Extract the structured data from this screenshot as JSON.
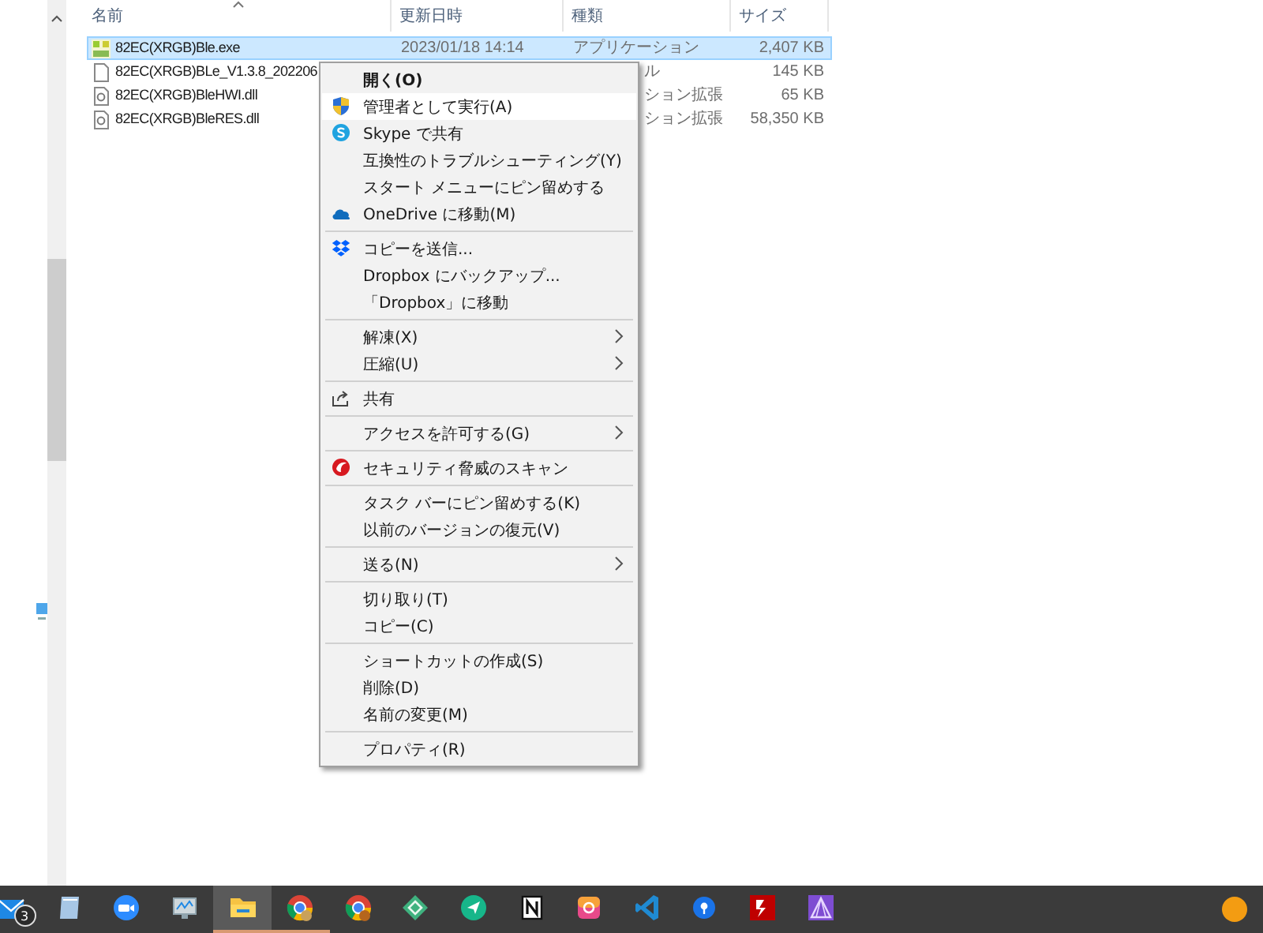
{
  "columns": [
    {
      "label": "名前",
      "sorted": true
    },
    {
      "label": "更新日時",
      "sorted": false
    },
    {
      "label": "種類",
      "sorted": false
    },
    {
      "label": "サイズ",
      "sorted": false
    }
  ],
  "files": [
    {
      "kind": "app",
      "name": "82EC(XRGB)Ble.exe",
      "date": "2023/01/18 14:14",
      "type": "アプリケーション",
      "size": "2,407 KB",
      "selected": true
    },
    {
      "kind": "file",
      "name": "82EC(XRGB)BLe_V1.3.8_202206",
      "type": "ル",
      "size": "145 KB",
      "selected": false
    },
    {
      "kind": "dll",
      "name": "82EC(XRGB)BleHWI.dll",
      "type": "ション拡張",
      "size": "65 KB",
      "selected": false
    },
    {
      "kind": "dll",
      "name": "82EC(XRGB)BleRES.dll",
      "type": "ション拡張",
      "size": "58,350 KB",
      "selected": false
    }
  ],
  "menu": [
    {
      "kind": "plain",
      "label": "開く(O)",
      "default": true,
      "selected": false,
      "submenu": false
    },
    {
      "kind": "shield",
      "label": "管理者として実行(A)",
      "default": false,
      "selected": true,
      "submenu": false
    },
    {
      "kind": "skype",
      "label": "Skype で共有",
      "default": false,
      "selected": false,
      "submenu": false
    },
    {
      "kind": "plain",
      "label": "互換性のトラブルシューティング(Y)",
      "default": false,
      "selected": false,
      "submenu": false
    },
    {
      "kind": "plain",
      "label": "スタート メニューにピン留めする",
      "default": false,
      "selected": false,
      "submenu": false
    },
    {
      "kind": "cloud",
      "label": "OneDrive に移動(M)",
      "default": false,
      "selected": false,
      "submenu": false
    },
    {
      "kind": "separator"
    },
    {
      "kind": "dropbox",
      "label": "コピーを送信...",
      "default": false,
      "selected": false,
      "submenu": false
    },
    {
      "kind": "plain",
      "label": "Dropbox にバックアップ...",
      "default": false,
      "selected": false,
      "submenu": false
    },
    {
      "kind": "plain",
      "label": "「Dropbox」に移動",
      "default": false,
      "selected": false,
      "submenu": false
    },
    {
      "kind": "separator"
    },
    {
      "kind": "plain",
      "label": "解凍(X)",
      "default": false,
      "selected": false,
      "submenu": true
    },
    {
      "kind": "plain",
      "label": "圧縮(U)",
      "default": false,
      "selected": false,
      "submenu": true
    },
    {
      "kind": "separator"
    },
    {
      "kind": "share",
      "label": "共有",
      "default": false,
      "selected": false,
      "submenu": false
    },
    {
      "kind": "separator"
    },
    {
      "kind": "plain",
      "label": "アクセスを許可する(G)",
      "default": false,
      "selected": false,
      "submenu": true
    },
    {
      "kind": "separator"
    },
    {
      "kind": "scan",
      "label": "セキュリティ脅威のスキャン",
      "default": false,
      "selected": false,
      "submenu": false
    },
    {
      "kind": "separator"
    },
    {
      "kind": "plain",
      "label": "タスク バーにピン留めする(K)",
      "default": false,
      "selected": false,
      "submenu": false
    },
    {
      "kind": "plain",
      "label": "以前のバージョンの復元(V)",
      "default": false,
      "selected": false,
      "submenu": false
    },
    {
      "kind": "separator"
    },
    {
      "kind": "plain",
      "label": "送る(N)",
      "default": false,
      "selected": false,
      "submenu": true
    },
    {
      "kind": "separator"
    },
    {
      "kind": "plain",
      "label": "切り取り(T)",
      "default": false,
      "selected": false,
      "submenu": false
    },
    {
      "kind": "plain",
      "label": "コピー(C)",
      "default": false,
      "selected": false,
      "submenu": false
    },
    {
      "kind": "separator"
    },
    {
      "kind": "plain",
      "label": "ショートカットの作成(S)",
      "default": false,
      "selected": false,
      "submenu": false
    },
    {
      "kind": "plain",
      "label": "削除(D)",
      "default": false,
      "selected": false,
      "submenu": false
    },
    {
      "kind": "plain",
      "label": "名前の変更(M)",
      "default": false,
      "selected": false,
      "submenu": false
    },
    {
      "kind": "separator"
    },
    {
      "kind": "plain",
      "label": "プロパティ(R)",
      "default": false,
      "selected": false,
      "submenu": false
    }
  ],
  "taskbar": [
    {
      "badge": "3",
      "active": false,
      "running": false
    },
    {
      "active": false,
      "running": false
    },
    {
      "active": false,
      "running": false
    },
    {
      "active": false,
      "running": false
    },
    {
      "active": true,
      "running": true
    },
    {
      "active": false,
      "running": true
    },
    {
      "active": false,
      "running": false
    },
    {
      "active": false,
      "running": false
    },
    {
      "active": false,
      "running": false
    },
    {
      "active": false,
      "running": false
    },
    {
      "active": false,
      "running": false
    },
    {
      "active": false,
      "running": false
    },
    {
      "active": false,
      "running": false
    },
    {
      "active": false,
      "running": false
    },
    {
      "active": false,
      "running": false
    }
  ]
}
